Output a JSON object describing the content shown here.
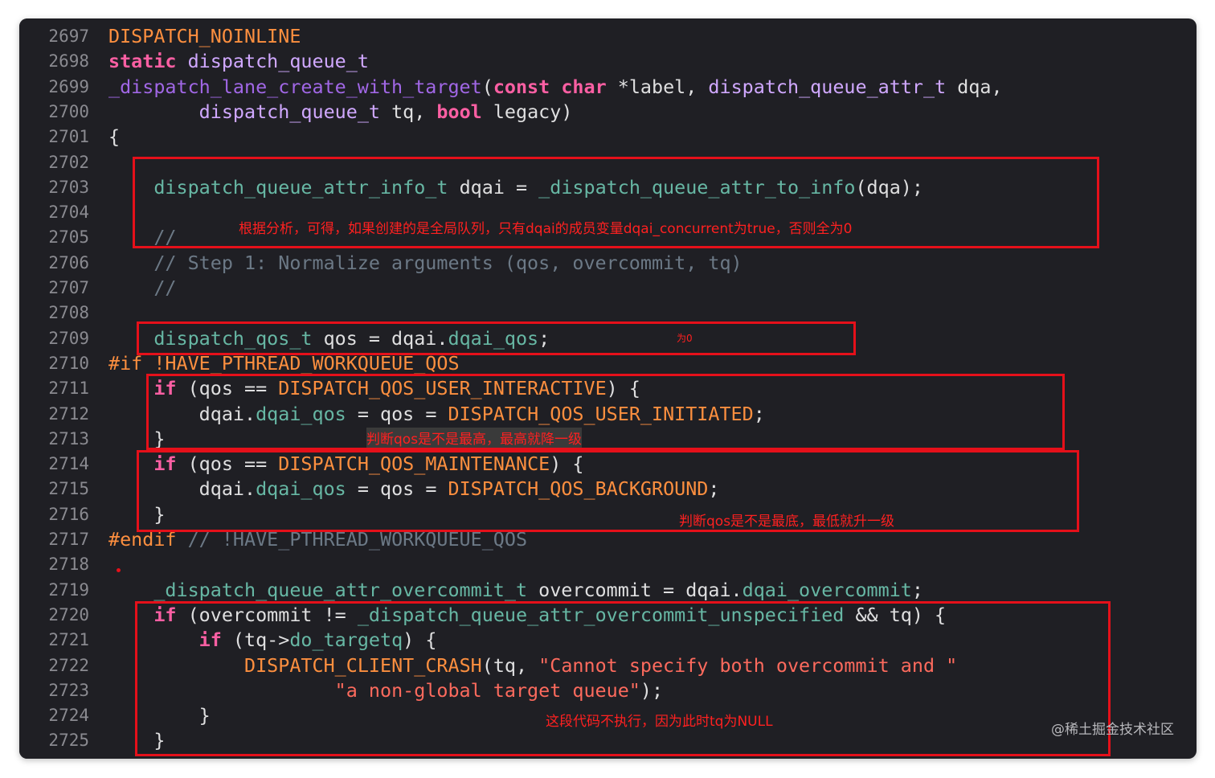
{
  "editor": {
    "line_numbers": [
      "2697",
      "2698",
      "2699",
      "2700",
      "2701",
      "2702",
      "2703",
      "2704",
      "2705",
      "2706",
      "2707",
      "2708",
      "2709",
      "2710",
      "2711",
      "2712",
      "2713",
      "2714",
      "2715",
      "2716",
      "2717",
      "2718",
      "2719",
      "2720",
      "2721",
      "2722",
      "2723",
      "2724",
      "2725"
    ],
    "lines": [
      [
        {
          "t": "DISPATCH_NOINLINE",
          "c": "pp"
        }
      ],
      [
        {
          "t": "static",
          "c": "kw"
        },
        {
          "t": " "
        },
        {
          "t": "dispatch_queue_t",
          "c": "ty"
        }
      ],
      [
        {
          "t": "_dispatch_lane_create_with_target",
          "c": "fn"
        },
        {
          "t": "("
        },
        {
          "t": "const",
          "c": "kw"
        },
        {
          "t": " "
        },
        {
          "t": "char",
          "c": "kw"
        },
        {
          "t": " *label, "
        },
        {
          "t": "dispatch_queue_attr_t",
          "c": "ty"
        },
        {
          "t": " dqa,"
        }
      ],
      [
        {
          "t": "        "
        },
        {
          "t": "dispatch_queue_t",
          "c": "ty"
        },
        {
          "t": " tq, "
        },
        {
          "t": "bool",
          "c": "kw"
        },
        {
          "t": " legacy)"
        }
      ],
      [
        {
          "t": "{"
        }
      ],
      [
        {
          "t": ""
        }
      ],
      [
        {
          "t": "    dispatch_queue_attr_info_t",
          "c": "mem"
        },
        {
          "t": " dqai = "
        },
        {
          "t": "_dispatch_queue_attr_to_info",
          "c": "mem"
        },
        {
          "t": "(dqa);"
        }
      ],
      [
        {
          "t": ""
        }
      ],
      [
        {
          "t": "    //",
          "c": "cm"
        }
      ],
      [
        {
          "t": "    // Step 1: Normalize arguments (qos, overcommit, tq)",
          "c": "cm"
        }
      ],
      [
        {
          "t": "    //",
          "c": "cm"
        }
      ],
      [
        {
          "t": ""
        }
      ],
      [
        {
          "t": "    dispatch_qos_t",
          "c": "mem"
        },
        {
          "t": " qos = dqai."
        },
        {
          "t": "dqai_qos",
          "c": "mem"
        },
        {
          "t": ";"
        }
      ],
      [
        {
          "t": "#if !HAVE_PTHREAD_WORKQUEUE_QOS",
          "c": "pp"
        }
      ],
      [
        {
          "t": "    "
        },
        {
          "t": "if",
          "c": "kw"
        },
        {
          "t": " (qos == "
        },
        {
          "t": "DISPATCH_QOS_USER_INTERACTIVE",
          "c": "mac"
        },
        {
          "t": ") {"
        }
      ],
      [
        {
          "t": "        dqai."
        },
        {
          "t": "dqai_qos",
          "c": "mem"
        },
        {
          "t": " = qos = "
        },
        {
          "t": "DISPATCH_QOS_USER_INITIATED",
          "c": "mac"
        },
        {
          "t": ";"
        }
      ],
      [
        {
          "t": "    }"
        }
      ],
      [
        {
          "t": "    "
        },
        {
          "t": "if",
          "c": "kw"
        },
        {
          "t": " (qos == "
        },
        {
          "t": "DISPATCH_QOS_MAINTENANCE",
          "c": "mac"
        },
        {
          "t": ") {"
        }
      ],
      [
        {
          "t": "        dqai."
        },
        {
          "t": "dqai_qos",
          "c": "mem"
        },
        {
          "t": " = qos = "
        },
        {
          "t": "DISPATCH_QOS_BACKGROUND",
          "c": "mac"
        },
        {
          "t": ";"
        }
      ],
      [
        {
          "t": "    }"
        }
      ],
      [
        {
          "t": "#endif",
          "c": "pp"
        },
        {
          "t": " // !HAVE_PTHREAD_WORKQUEUE_QOS",
          "c": "cm"
        }
      ],
      [
        {
          "t": ""
        }
      ],
      [
        {
          "t": "    _dispatch_queue_attr_overcommit_t",
          "c": "mem"
        },
        {
          "t": " overcommit = dqai."
        },
        {
          "t": "dqai_overcommit",
          "c": "mem"
        },
        {
          "t": ";"
        }
      ],
      [
        {
          "t": "    "
        },
        {
          "t": "if",
          "c": "kw"
        },
        {
          "t": " (overcommit != "
        },
        {
          "t": "_dispatch_queue_attr_overcommit_unspecified",
          "c": "mem"
        },
        {
          "t": " && tq) {"
        }
      ],
      [
        {
          "t": "        "
        },
        {
          "t": "if",
          "c": "kw"
        },
        {
          "t": " (tq->"
        },
        {
          "t": "do_targetq",
          "c": "mem"
        },
        {
          "t": ") {"
        }
      ],
      [
        {
          "t": "            "
        },
        {
          "t": "DISPATCH_CLIENT_CRASH",
          "c": "mac"
        },
        {
          "t": "(tq, "
        },
        {
          "t": "\"Cannot specify both overcommit and \"",
          "c": "st"
        }
      ],
      [
        {
          "t": "                    "
        },
        {
          "t": "\"a non-global target queue\"",
          "c": "st"
        },
        {
          "t": ");"
        }
      ],
      [
        {
          "t": "        }"
        }
      ],
      [
        {
          "t": "    }"
        }
      ]
    ]
  },
  "annotations": {
    "note1": "根据分析，可得，如果创建的是全局队列，只有dqai的成员变量dqai_concurrent为true，否则全为0",
    "note2": "为0",
    "note3": "判断qos是不是最高，最高就降一级",
    "note4": "判断qos是不是最底，最低就升一级",
    "note5": "这段代码不执行，因为此时tq为NULL"
  },
  "watermark": "@稀土掘金技术社区",
  "colors": {
    "background": "#1f1f24",
    "annotation": "#e5101a"
  }
}
